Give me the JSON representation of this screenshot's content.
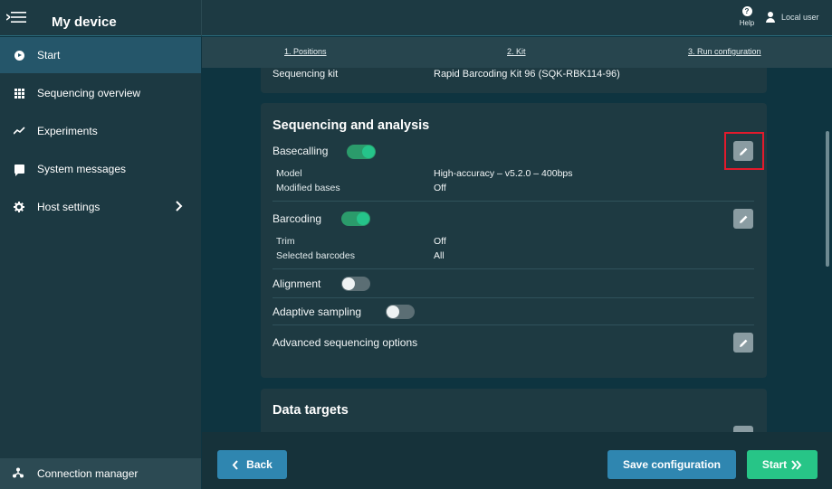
{
  "header": {
    "title": "My device",
    "help_label": "Help",
    "user_label": "Local user"
  },
  "sidebar": {
    "items": [
      {
        "label": "Start"
      },
      {
        "label": "Sequencing overview"
      },
      {
        "label": "Experiments"
      },
      {
        "label": "System messages"
      },
      {
        "label": "Host settings"
      }
    ],
    "footer_label": "Connection manager"
  },
  "steps": [
    {
      "label": "1. Positions"
    },
    {
      "label": "2. Kit"
    },
    {
      "label": "3. Run configuration"
    }
  ],
  "kit": {
    "label": "Sequencing kit",
    "value": "Rapid Barcoding Kit 96 (SQK-RBK114-96)"
  },
  "analysis": {
    "title": "Sequencing and analysis",
    "basecalling": {
      "label": "Basecalling",
      "enabled": true,
      "model_label": "Model",
      "model_value": "High-accuracy – v5.2.0 – 400bps",
      "mods_label": "Modified bases",
      "mods_value": "Off"
    },
    "barcoding": {
      "label": "Barcoding",
      "enabled": true,
      "trim_label": "Trim",
      "trim_value": "Off",
      "selected_label": "Selected barcodes",
      "selected_value": "All"
    },
    "alignment": {
      "label": "Alignment",
      "enabled": false
    },
    "adaptive": {
      "label": "Adaptive sampling",
      "enabled": false
    },
    "advanced_label": "Advanced sequencing options"
  },
  "data_targets": {
    "title": "Data targets"
  },
  "buttons": {
    "back": "Back",
    "save": "Save configuration",
    "start": "Start"
  },
  "colors": {
    "accent_blue": "#2f86b0",
    "accent_green": "#27c587",
    "highlight_red": "#e21a2c"
  },
  "icons": {
    "menu": "menu-back-icon",
    "edit": "pencil-icon"
  }
}
